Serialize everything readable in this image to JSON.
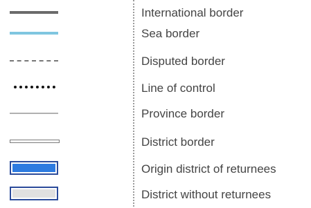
{
  "legend": {
    "items": [
      {
        "label": "International border",
        "symbol": "solid-thick-line",
        "color": "#6b6b6b"
      },
      {
        "label": "Sea border",
        "symbol": "solid-thick-line",
        "color": "#7fc6e0"
      },
      {
        "label": "Disputed border",
        "symbol": "dashed-line",
        "color": "#777777"
      },
      {
        "label": "Line of control",
        "symbol": "dotted-line",
        "color": "#111111"
      },
      {
        "label": "Province border",
        "symbol": "solid-thin-line",
        "color": "#b0b0b0"
      },
      {
        "label": "District border",
        "symbol": "double-line",
        "color": "#7a7a7a"
      },
      {
        "label": "Origin district of returnees",
        "symbol": "filled-box",
        "color": "#2e7be0"
      },
      {
        "label": "District without returnees",
        "symbol": "filled-box",
        "color": "#e0e0e0"
      }
    ]
  }
}
